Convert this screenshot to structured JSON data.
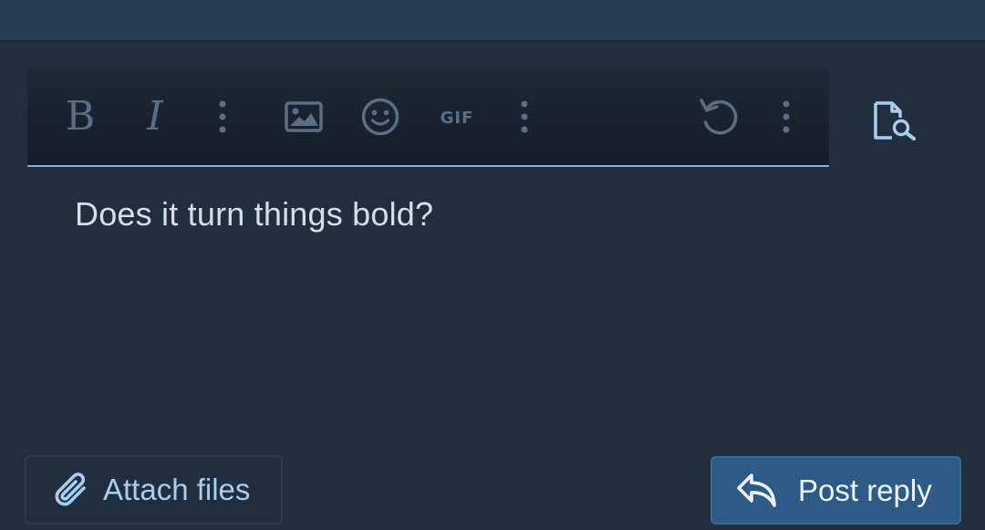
{
  "editor": {
    "content": "Does it turn things bold?",
    "toolbar": {
      "bold_glyph": "B",
      "italic_glyph": "I",
      "gif_label": "GIF"
    }
  },
  "actions": {
    "attach_label": "Attach files",
    "post_label": "Post reply"
  },
  "colors": {
    "background": "#212e3e",
    "accent": "#7bb3e2",
    "primary_button": "#2d5a86"
  },
  "icons": [
    "bold-icon",
    "italic-icon",
    "more-options-icon",
    "image-icon",
    "emoji-icon",
    "gif-icon",
    "undo-icon",
    "preview-icon",
    "paperclip-icon",
    "reply-icon"
  ]
}
